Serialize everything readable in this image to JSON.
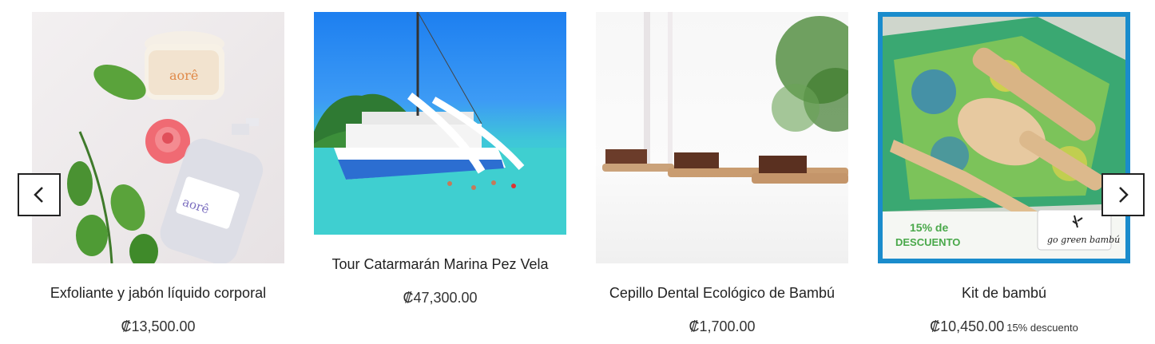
{
  "carousel": {
    "prev_icon": "chevron-left-icon",
    "next_icon": "chevron-right-icon",
    "products": [
      {
        "title": "Exfoliante y jabón líquido corporal",
        "price": "₡13,500.00"
      },
      {
        "title": "Tour Catarmarán Marina Pez Vela",
        "price": "₡47,300.00"
      },
      {
        "title": "Cepillo Dental Ecológico de Bambú",
        "price": "₡1,700.00"
      },
      {
        "title": "Kit de bambú",
        "price": "₡10,450.00",
        "discount": "15% descuento",
        "banner": {
          "pct": "15% de",
          "word": "DESCUENTO",
          "logo": "go green bambú"
        }
      }
    ]
  },
  "colors": {
    "border": "#222222",
    "banner_green": "#4caf50",
    "frame_blue": "#1a8ccc"
  }
}
